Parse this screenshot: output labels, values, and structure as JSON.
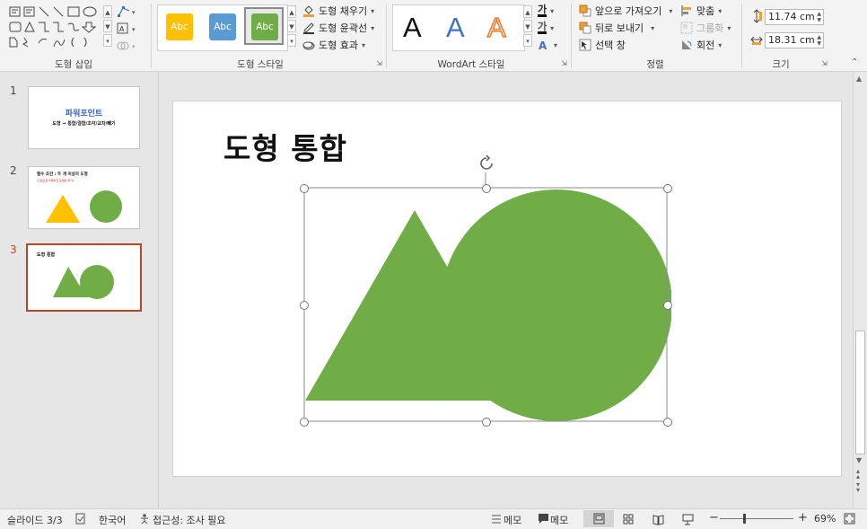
{
  "ribbon": {
    "groups": {
      "shape_insert": "도형 삽입",
      "shape_styles": "도형 스타일",
      "wordart_styles": "WordArt 스타일",
      "arrange": "정렬",
      "size": "크기"
    },
    "style_presets": [
      "Abc",
      "Abc",
      "Abc"
    ],
    "style_preset_colors": [
      "#ffc000",
      "#5b9bd5",
      "#70ad47"
    ],
    "shape_fill": "도형 채우기",
    "shape_outline": "도형 윤곽선",
    "shape_effects": "도형 효과",
    "wordart_letters": [
      "A",
      "A",
      "A"
    ],
    "text_fill_glyph": "가",
    "text_outline_glyph": "가",
    "bring_forward": "앞으로 가져오기",
    "send_backward": "뒤로 보내기",
    "selection_pane": "선택 창",
    "align": "맞춤",
    "group": "그룹화",
    "rotate": "회전",
    "height_value": "11.74 cm",
    "width_value": "18.31 cm"
  },
  "slides": [
    {
      "number": "1",
      "title": "파워포인트",
      "subtitle": "도형 → 통합/결합/조각/교차/빼기"
    },
    {
      "number": "2",
      "title": "필수 조건 : 두 개 이상의 도형",
      "subtitle": "(그림으로 이루어진 도형은 불가)"
    },
    {
      "number": "3",
      "title": "도형 통합"
    }
  ],
  "active_slide": "3",
  "main_slide": {
    "title": "도형 통합",
    "shape_color": "#70ad47"
  },
  "statusbar": {
    "slide_indicator": "슬라이드 3/3",
    "language": "한국어",
    "accessibility": "접근성: 조사 필요",
    "notes": "메모",
    "comments": "메모",
    "zoom": "69%"
  },
  "colors": {
    "accent": "#b7472a",
    "selection": "#888888"
  }
}
